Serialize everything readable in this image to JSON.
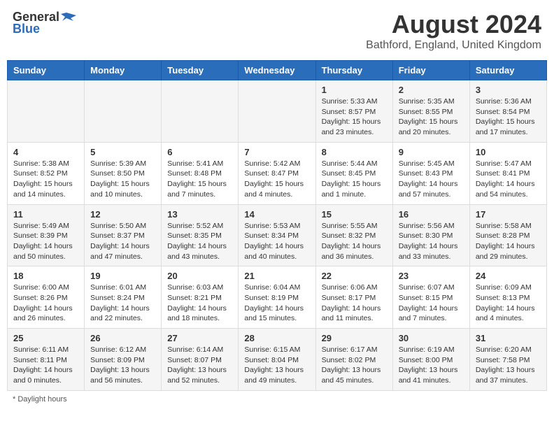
{
  "header": {
    "logo_general": "General",
    "logo_blue": "Blue",
    "month_year": "August 2024",
    "location": "Bathford, England, United Kingdom"
  },
  "days_of_week": [
    "Sunday",
    "Monday",
    "Tuesday",
    "Wednesday",
    "Thursday",
    "Friday",
    "Saturday"
  ],
  "weeks": [
    [
      {
        "day": "",
        "info": ""
      },
      {
        "day": "",
        "info": ""
      },
      {
        "day": "",
        "info": ""
      },
      {
        "day": "",
        "info": ""
      },
      {
        "day": "1",
        "info": "Sunrise: 5:33 AM\nSunset: 8:57 PM\nDaylight: 15 hours\nand 23 minutes."
      },
      {
        "day": "2",
        "info": "Sunrise: 5:35 AM\nSunset: 8:55 PM\nDaylight: 15 hours\nand 20 minutes."
      },
      {
        "day": "3",
        "info": "Sunrise: 5:36 AM\nSunset: 8:54 PM\nDaylight: 15 hours\nand 17 minutes."
      }
    ],
    [
      {
        "day": "4",
        "info": "Sunrise: 5:38 AM\nSunset: 8:52 PM\nDaylight: 15 hours\nand 14 minutes."
      },
      {
        "day": "5",
        "info": "Sunrise: 5:39 AM\nSunset: 8:50 PM\nDaylight: 15 hours\nand 10 minutes."
      },
      {
        "day": "6",
        "info": "Sunrise: 5:41 AM\nSunset: 8:48 PM\nDaylight: 15 hours\nand 7 minutes."
      },
      {
        "day": "7",
        "info": "Sunrise: 5:42 AM\nSunset: 8:47 PM\nDaylight: 15 hours\nand 4 minutes."
      },
      {
        "day": "8",
        "info": "Sunrise: 5:44 AM\nSunset: 8:45 PM\nDaylight: 15 hours\nand 1 minute."
      },
      {
        "day": "9",
        "info": "Sunrise: 5:45 AM\nSunset: 8:43 PM\nDaylight: 14 hours\nand 57 minutes."
      },
      {
        "day": "10",
        "info": "Sunrise: 5:47 AM\nSunset: 8:41 PM\nDaylight: 14 hours\nand 54 minutes."
      }
    ],
    [
      {
        "day": "11",
        "info": "Sunrise: 5:49 AM\nSunset: 8:39 PM\nDaylight: 14 hours\nand 50 minutes."
      },
      {
        "day": "12",
        "info": "Sunrise: 5:50 AM\nSunset: 8:37 PM\nDaylight: 14 hours\nand 47 minutes."
      },
      {
        "day": "13",
        "info": "Sunrise: 5:52 AM\nSunset: 8:35 PM\nDaylight: 14 hours\nand 43 minutes."
      },
      {
        "day": "14",
        "info": "Sunrise: 5:53 AM\nSunset: 8:34 PM\nDaylight: 14 hours\nand 40 minutes."
      },
      {
        "day": "15",
        "info": "Sunrise: 5:55 AM\nSunset: 8:32 PM\nDaylight: 14 hours\nand 36 minutes."
      },
      {
        "day": "16",
        "info": "Sunrise: 5:56 AM\nSunset: 8:30 PM\nDaylight: 14 hours\nand 33 minutes."
      },
      {
        "day": "17",
        "info": "Sunrise: 5:58 AM\nSunset: 8:28 PM\nDaylight: 14 hours\nand 29 minutes."
      }
    ],
    [
      {
        "day": "18",
        "info": "Sunrise: 6:00 AM\nSunset: 8:26 PM\nDaylight: 14 hours\nand 26 minutes."
      },
      {
        "day": "19",
        "info": "Sunrise: 6:01 AM\nSunset: 8:24 PM\nDaylight: 14 hours\nand 22 minutes."
      },
      {
        "day": "20",
        "info": "Sunrise: 6:03 AM\nSunset: 8:21 PM\nDaylight: 14 hours\nand 18 minutes."
      },
      {
        "day": "21",
        "info": "Sunrise: 6:04 AM\nSunset: 8:19 PM\nDaylight: 14 hours\nand 15 minutes."
      },
      {
        "day": "22",
        "info": "Sunrise: 6:06 AM\nSunset: 8:17 PM\nDaylight: 14 hours\nand 11 minutes."
      },
      {
        "day": "23",
        "info": "Sunrise: 6:07 AM\nSunset: 8:15 PM\nDaylight: 14 hours\nand 7 minutes."
      },
      {
        "day": "24",
        "info": "Sunrise: 6:09 AM\nSunset: 8:13 PM\nDaylight: 14 hours\nand 4 minutes."
      }
    ],
    [
      {
        "day": "25",
        "info": "Sunrise: 6:11 AM\nSunset: 8:11 PM\nDaylight: 14 hours\nand 0 minutes."
      },
      {
        "day": "26",
        "info": "Sunrise: 6:12 AM\nSunset: 8:09 PM\nDaylight: 13 hours\nand 56 minutes."
      },
      {
        "day": "27",
        "info": "Sunrise: 6:14 AM\nSunset: 8:07 PM\nDaylight: 13 hours\nand 52 minutes."
      },
      {
        "day": "28",
        "info": "Sunrise: 6:15 AM\nSunset: 8:04 PM\nDaylight: 13 hours\nand 49 minutes."
      },
      {
        "day": "29",
        "info": "Sunrise: 6:17 AM\nSunset: 8:02 PM\nDaylight: 13 hours\nand 45 minutes."
      },
      {
        "day": "30",
        "info": "Sunrise: 6:19 AM\nSunset: 8:00 PM\nDaylight: 13 hours\nand 41 minutes."
      },
      {
        "day": "31",
        "info": "Sunrise: 6:20 AM\nSunset: 7:58 PM\nDaylight: 13 hours\nand 37 minutes."
      }
    ]
  ],
  "footer": {
    "note": "Daylight hours"
  }
}
